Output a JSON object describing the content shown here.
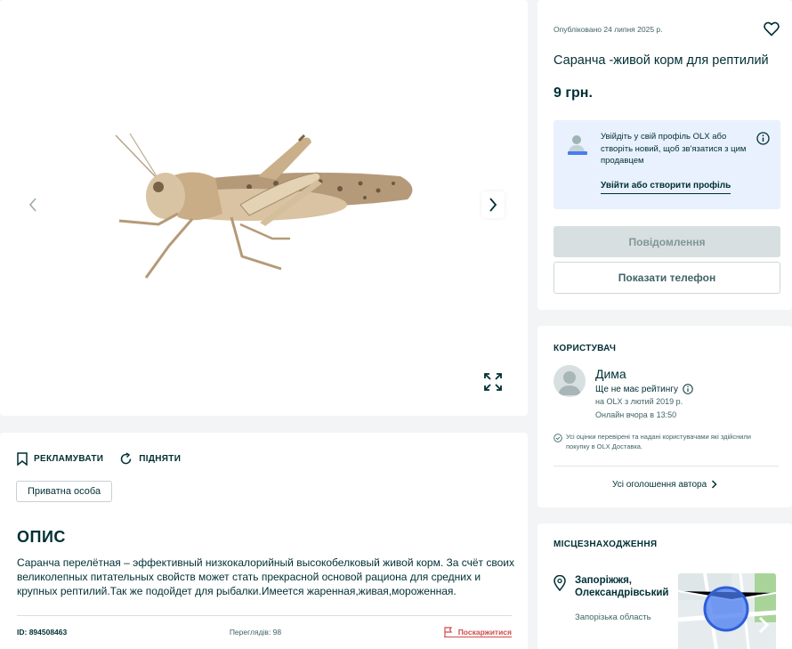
{
  "gallery": {
    "prev_icon": "chevron-left-icon",
    "next_icon": "chevron-right-icon",
    "expand_icon": "expand-icon"
  },
  "actions": {
    "promote_label": "РЕКЛАМУВАТИ",
    "raise_label": "ПІДНЯТИ"
  },
  "ad": {
    "seller_type": "Приватна особа",
    "description_heading": "ОПИС",
    "description": "Саранча перелётная – эффективный низкокалорийный высокобелковый живой корм. За счёт своих великолепных питательных свойств может стать прекрасной основой рациона для средних и крупных рептилий.Так же подойдет для рыбалки.Имеется жаренная,живая,мороженная.",
    "id_text": "ID: 894508463",
    "views_text": "Переглядів: 98",
    "complain_label": "Поскаржитися"
  },
  "listing": {
    "published": "Опубліковано 24 липня 2025 р.",
    "title": "Саранча -живой корм для рептилий",
    "price": "9 грн.",
    "login_prompt": "Увійдіть у свій профіль OLX або створіть новий, щоб зв'язатися з цим продавцем",
    "login_link": "Увійти або створити профіль",
    "message_button": "Повідомлення",
    "phone_button": "Показати телефон"
  },
  "user": {
    "section_title": "КОРИСТУВАЧ",
    "name": "Дима",
    "rating": "Ще не має рейтингу",
    "since": "на OLX з лютий 2019 р.",
    "online": "Онлайн вчора в 13:50",
    "note": "Усі оцінки перевірені та надані користувачами які здійснили покупку в OLX Доставка.",
    "all_ads": "Усі оголошення автора"
  },
  "location": {
    "section_title": "МІСЦЕЗНАХОДЖЕННЯ",
    "city": "Запоріжжя, Олександрівський",
    "region": "Запорізька область"
  },
  "colors": {
    "text": "#002f34",
    "page_bg": "#f2f4f5",
    "login_bg": "#e8f1fd",
    "disabled_btn": "#d8dfe0",
    "complain": "#d24b4b",
    "map_circle": "#4a7cf0"
  }
}
